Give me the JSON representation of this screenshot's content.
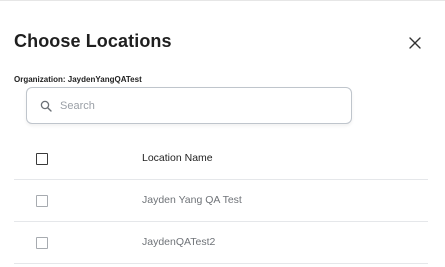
{
  "dialog": {
    "title": "Choose Locations",
    "close_icon": "close-icon"
  },
  "organization": {
    "label": "Organization: JaydenYangQATest"
  },
  "search": {
    "placeholder": "Search",
    "value": "",
    "icon": "search-icon"
  },
  "table": {
    "header": {
      "column_label": "Location Name",
      "checked": false
    },
    "rows": [
      {
        "name": "Jayden Yang QA Test",
        "checked": false
      },
      {
        "name": "JaydenQATest2",
        "checked": false
      }
    ]
  },
  "colors": {
    "title": "#1f1f1f",
    "muted_text": "#6f7378",
    "border": "#bfc5cc",
    "divider": "#e5e7ea"
  }
}
